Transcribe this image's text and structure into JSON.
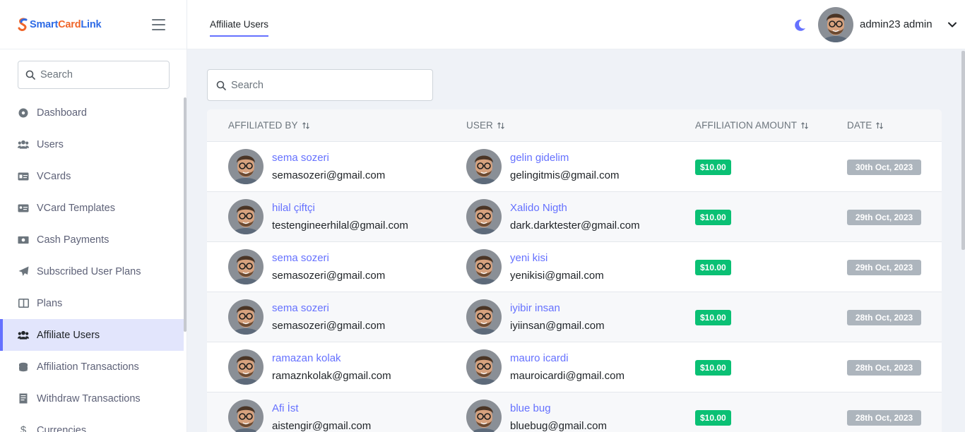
{
  "brand": {
    "part1": "Smart",
    "part2": "Card",
    "part3": "Link"
  },
  "sidebar": {
    "search_placeholder": "Search",
    "items": [
      {
        "label": "Dashboard",
        "icon": "dashboard-icon"
      },
      {
        "label": "Users",
        "icon": "users-icon"
      },
      {
        "label": "VCards",
        "icon": "vcard-icon"
      },
      {
        "label": "VCard Templates",
        "icon": "vcard-templates-icon"
      },
      {
        "label": "Cash Payments",
        "icon": "cash-icon"
      },
      {
        "label": "Subscribed User Plans",
        "icon": "paper-plane-icon"
      },
      {
        "label": "Plans",
        "icon": "plans-icon"
      },
      {
        "label": "Affiliate Users",
        "icon": "users-icon",
        "active": true
      },
      {
        "label": "Affiliation Transactions",
        "icon": "coins-icon"
      },
      {
        "label": "Withdraw Transactions",
        "icon": "receipt-icon"
      },
      {
        "label": "Currencies",
        "icon": "dollar-icon"
      }
    ]
  },
  "header": {
    "tab": "Affiliate Users",
    "user_name": "admin23 admin",
    "theme_icon": "moon-icon",
    "accent": "#6571ff"
  },
  "main": {
    "search_placeholder": "Search",
    "columns": [
      "AFFILIATED BY",
      "USER",
      "AFFILIATION AMOUNT",
      "DATE"
    ],
    "rows": [
      {
        "by_name": "sema sozeri",
        "by_email": "semasozeri@gmail.com",
        "user_name": "gelin gidelim",
        "user_email": "gelingitmis@gmail.com",
        "amount": "$10.00",
        "date": "30th Oct, 2023"
      },
      {
        "by_name": "hilal çiftçi",
        "by_email": "testengineerhilal@gmail.com",
        "user_name": "Xalido Nigth",
        "user_email": "dark.darktester@gmail.com",
        "amount": "$10.00",
        "date": "29th Oct, 2023"
      },
      {
        "by_name": "sema sozeri",
        "by_email": "semasozeri@gmail.com",
        "user_name": "yeni kisi",
        "user_email": "yenikisi@gmail.com",
        "amount": "$10.00",
        "date": "29th Oct, 2023"
      },
      {
        "by_name": "sema sozeri",
        "by_email": "semasozeri@gmail.com",
        "user_name": "iyibir insan",
        "user_email": "iyiinsan@gmail.com",
        "amount": "$10.00",
        "date": "28th Oct, 2023"
      },
      {
        "by_name": "ramazan kolak",
        "by_email": "ramaznkolak@gmail.com",
        "user_name": "mauro icardi",
        "user_email": "mauroicardi@gmail.com",
        "amount": "$10.00",
        "date": "28th Oct, 2023"
      },
      {
        "by_name": "Afi İst",
        "by_email": "aistengir@gmail.com",
        "user_name": "blue bug",
        "user_email": "bluebug@gmail.com",
        "amount": "$10.00",
        "date": "28th Oct, 2023"
      }
    ]
  }
}
